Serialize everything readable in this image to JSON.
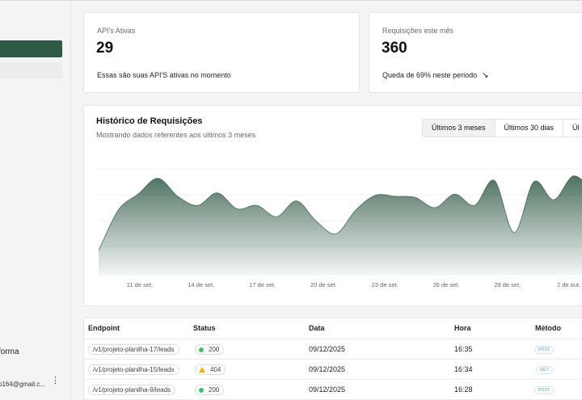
{
  "sidebar": {
    "org_label": "forma",
    "user_email": "o164@gmail.c..."
  },
  "stats": [
    {
      "label": "API's Ativas",
      "value": "29",
      "description": "Essas são suas API'S ativas no momento"
    },
    {
      "label": "Requisições este mês",
      "value": "360",
      "description": "Queda de 69% neste periodo",
      "trend_icon": "↘"
    }
  ],
  "chart_section": {
    "title": "Histórico de Requisições",
    "subtitle": "Mostrando dados referentes aos ultimos 3 meses",
    "ranges": [
      "Últimos 3 meses",
      "Últimos 30 dias",
      "Úl"
    ],
    "active_range": "Últimos 3 meses"
  },
  "chart_data": {
    "type": "area",
    "x_ticks": [
      "11 de set.",
      "14 de set.",
      "17 de set.",
      "20 de set.",
      "23 de set.",
      "26 de set.",
      "29 de set.",
      "2 de out."
    ],
    "ylim": [
      0,
      100
    ],
    "grid": true,
    "color": "#2f5a45",
    "values": [
      22,
      58,
      72,
      86,
      70,
      62,
      73,
      59,
      62,
      52,
      66,
      48,
      37,
      58,
      71,
      70,
      69,
      60,
      72,
      62,
      84,
      38,
      83,
      67,
      88,
      74
    ]
  },
  "table": {
    "headers": [
      "Endpoint",
      "Status",
      "Data",
      "Hora",
      "Método"
    ],
    "rows": [
      {
        "endpoint": "/v1/projeto-planilha-17/leads",
        "status": "200",
        "status_type": "ok",
        "date": "09/12/2025",
        "time": "16:35",
        "method": "POST"
      },
      {
        "endpoint": "/v1/projeto-planilha-15/leads",
        "status": "404",
        "status_type": "warn",
        "date": "09/12/2025",
        "time": "16:34",
        "method": "GET"
      },
      {
        "endpoint": "/v1/projeto-planilha-9/leads",
        "status": "200",
        "status_type": "ok",
        "date": "09/12/2025",
        "time": "16:28",
        "method": "POST"
      }
    ]
  }
}
